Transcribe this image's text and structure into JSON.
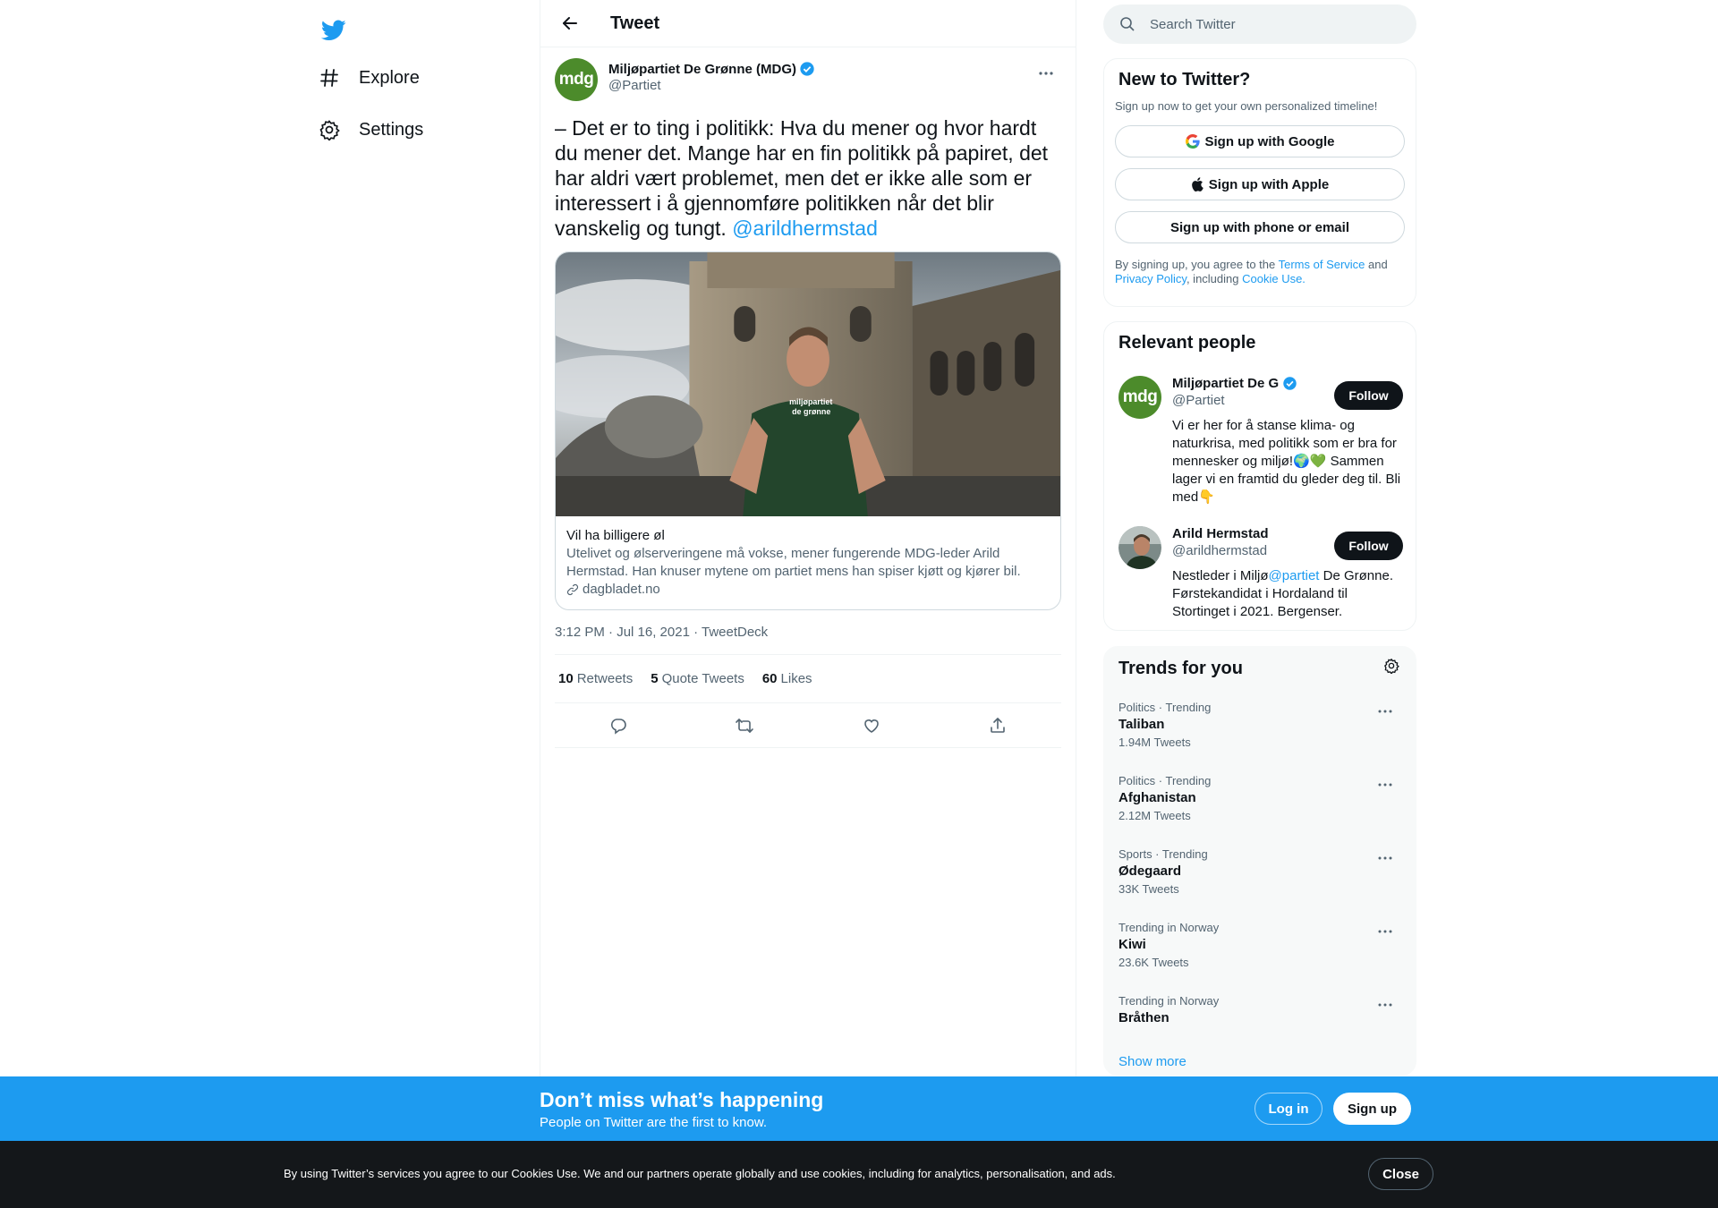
{
  "nav": {
    "explore_label": "Explore",
    "settings_label": "Settings"
  },
  "header": {
    "title": "Tweet"
  },
  "tweet": {
    "author_name": "Miljøpartiet De Grønne (MDG)",
    "author_handle": "@Partiet",
    "avatar_text": "mdg",
    "text": "– Det er to ting i politikk: Hva du mener og hvor hardt du mener det. Mange har en fin politikk på papiret, det har aldri vært problemet, men det er ikke alle som er interessert i å gjennomføre politikken når det blir vanskelig og tungt. ",
    "mention": "@arildhermstad",
    "card": {
      "shirt_text_1": "miljøpartiet",
      "shirt_text_2": "de grønne",
      "title": "Vil ha billigere øl",
      "description": "Utelivet og ølserveringene må vokse, mener fungerende MDG-leder Arild Hermstad. Han knuser mytene om partiet mens han spiser kjøtt og kjører bil.",
      "domain": "dagbladet.no"
    },
    "meta": "3:12 PM · Jul 16, 2021 · TweetDeck",
    "stats": {
      "retweets_count": "10",
      "retweets_label": "Retweets",
      "quotes_count": "5",
      "quotes_label": "Quote Tweets",
      "likes_count": "60",
      "likes_label": "Likes"
    }
  },
  "search": {
    "placeholder": "Search Twitter"
  },
  "new_to_twitter": {
    "title": "New to Twitter?",
    "subtitle": "Sign up now to get your own personalized timeline!",
    "google_label": "Sign up with Google",
    "apple_label": "Sign up with Apple",
    "phone_label": "Sign up with phone or email",
    "terms_prefix": "By signing up, you agree to the ",
    "terms_link": "Terms of Service",
    "terms_and": " and",
    "privacy_link": "Privacy Policy",
    "terms_including": ", including ",
    "cookie_link": "Cookie Use."
  },
  "relevant": {
    "title": "Relevant people",
    "people": [
      {
        "name": "Miljøpartiet De Grønne (MDG)",
        "handle": "@Partiet",
        "avatar_text": "mdg",
        "follow_label": "Follow",
        "bio": "Vi er her for å stanse klima- og naturkrisa, med politikk som er bra for mennesker og miljø!🌍💚 Sammen lager vi en framtid du gleder deg til. Bli med👇"
      },
      {
        "name": "Arild Hermstad",
        "handle": "@arildhermstad",
        "follow_label": "Follow",
        "bio_before": "Nestleder i Miljø",
        "bio_link": "@partiet",
        "bio_after": " De Grønne. Førstekandidat i Hordaland til Stortinget i 2021. Bergenser."
      }
    ]
  },
  "trends": {
    "title": "Trends for you",
    "items": [
      {
        "meta": "Politics · Trending",
        "name": "Taliban",
        "count": "1.94M Tweets"
      },
      {
        "meta": "Politics · Trending",
        "name": "Afghanistan",
        "count": "2.12M Tweets"
      },
      {
        "meta": "Sports · Trending",
        "name": "Ødegaard",
        "count": "33K Tweets"
      },
      {
        "meta": "Trending in Norway",
        "name": "Kiwi",
        "count": "23.6K Tweets"
      },
      {
        "meta": "Trending in Norway",
        "name": "Bråthen",
        "count": ""
      }
    ],
    "show_more": "Show more"
  },
  "banner": {
    "title": "Don’t miss what’s happening",
    "subtitle": "People on Twitter are the first to know.",
    "login_label": "Log in",
    "signup_label": "Sign up"
  },
  "cookie": {
    "text": "By using Twitter’s services you agree to our Cookies Use. We and our partners operate globally and use cookies, including for analytics, personalisation, and ads.",
    "close_label": "Close"
  },
  "colors": {
    "accent": "#1d9bf0",
    "mdg_green": "#4c8b2b",
    "dark": "#0f1419",
    "muted": "#536471"
  }
}
